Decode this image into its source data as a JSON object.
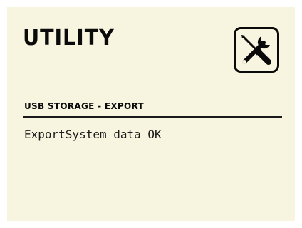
{
  "header": {
    "title": "UTILITY",
    "icon": "wrench-screwdriver-icon"
  },
  "section": {
    "heading": "USB STORAGE - EXPORT"
  },
  "status": {
    "message": "ExportSystem data OK"
  },
  "colors": {
    "background": "#f7f4df",
    "text": "#0a0a0a"
  }
}
